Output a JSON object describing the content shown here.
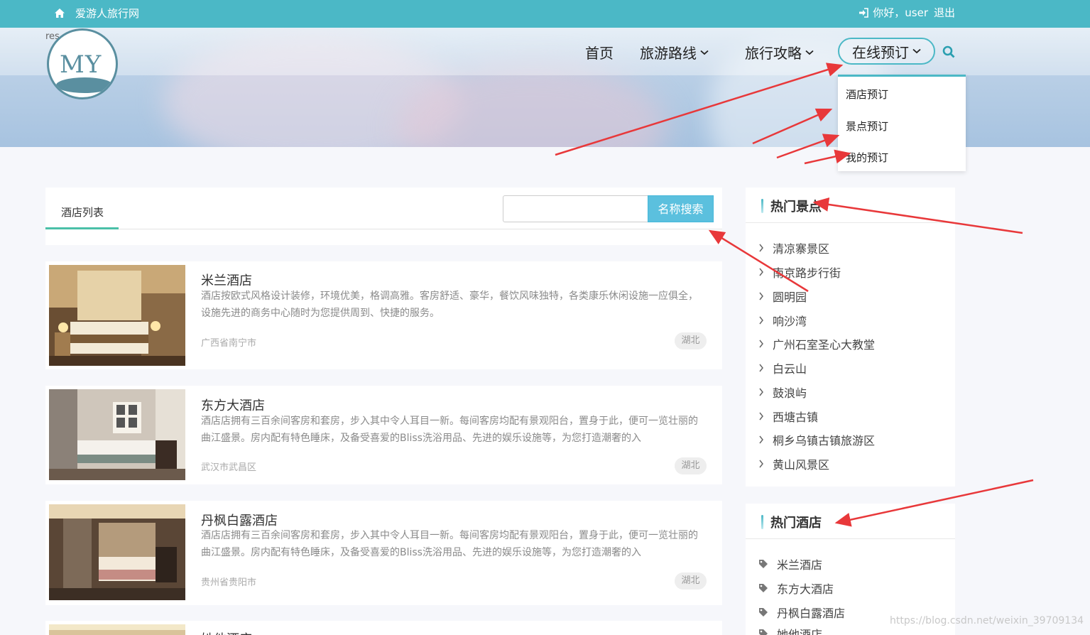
{
  "topbar": {
    "site_name": "爱游人旅行网",
    "greeting": "你好，user",
    "logout": "退出"
  },
  "banner": {
    "res_text": "res"
  },
  "logo": {
    "text": "MY"
  },
  "nav": {
    "items": [
      {
        "label": "首页",
        "has_dropdown": false
      },
      {
        "label": "旅游路线",
        "has_dropdown": true
      },
      {
        "label": "旅行攻略",
        "has_dropdown": true
      },
      {
        "label": "在线预订",
        "has_dropdown": true,
        "active": true
      }
    ],
    "dropdown": [
      "酒店预订",
      "景点预订",
      "我的预订"
    ]
  },
  "list": {
    "tab": "酒店列表",
    "search_button": "名称搜索",
    "search_value": "",
    "hotels": [
      {
        "name": "米兰酒店",
        "desc": "酒店按欧式风格设计装修，环境优美，格调高雅。客房舒适、豪华，餐饮风味独特，各类康乐休闲设施一应俱全，设施先进的商务中心随时为您提供周到、快捷的服务。",
        "location": "广西省南宁市",
        "tag": "湖北"
      },
      {
        "name": "东方大酒店",
        "desc": "酒店店拥有三百余间客房和套房，步入其中令人耳目一新。每间客房均配有景观阳台，置身于此，便可一览壮丽的曲江盛景。房内配有特色睡床，及备受喜爱的Bliss洗浴用品、先进的娱乐设施等，为您打造潮奢的入",
        "location": "武汉市武昌区",
        "tag": "湖北"
      },
      {
        "name": "丹枫白露酒店",
        "desc": "酒店店拥有三百余间客房和套房，步入其中令人耳目一新。每间客房均配有景观阳台，置身于此，便可一览壮丽的曲江盛景。房内配有特色睡床，及备受喜爱的Bliss洗浴用品、先进的娱乐设施等，为您打造潮奢的入",
        "location": "贵州省贵阳市",
        "tag": "湖北"
      },
      {
        "name": "她他酒店",
        "desc": "",
        "location": "",
        "tag": ""
      }
    ]
  },
  "sidebar": {
    "hot_spots_title": "热门景点",
    "hot_spots": [
      "清凉寨景区",
      "南京路步行街",
      "圆明园",
      "响沙湾",
      "广州石室圣心大教堂",
      "白云山",
      "鼓浪屿",
      "西塘古镇",
      "桐乡乌镇古镇旅游区",
      "黄山风景区"
    ],
    "hot_hotels_title": "热门酒店",
    "hot_hotels": [
      "米兰酒店",
      "东方大酒店",
      "丹枫白露酒店",
      "她他酒店"
    ]
  },
  "watermark": "https://blog.csdn.net/weixin_39709134",
  "colors": {
    "accent": "#4bb8c6",
    "tab_underline": "#4ac0a8",
    "search_button": "#5bc0de",
    "annotation_arrow": "#e8383a"
  }
}
